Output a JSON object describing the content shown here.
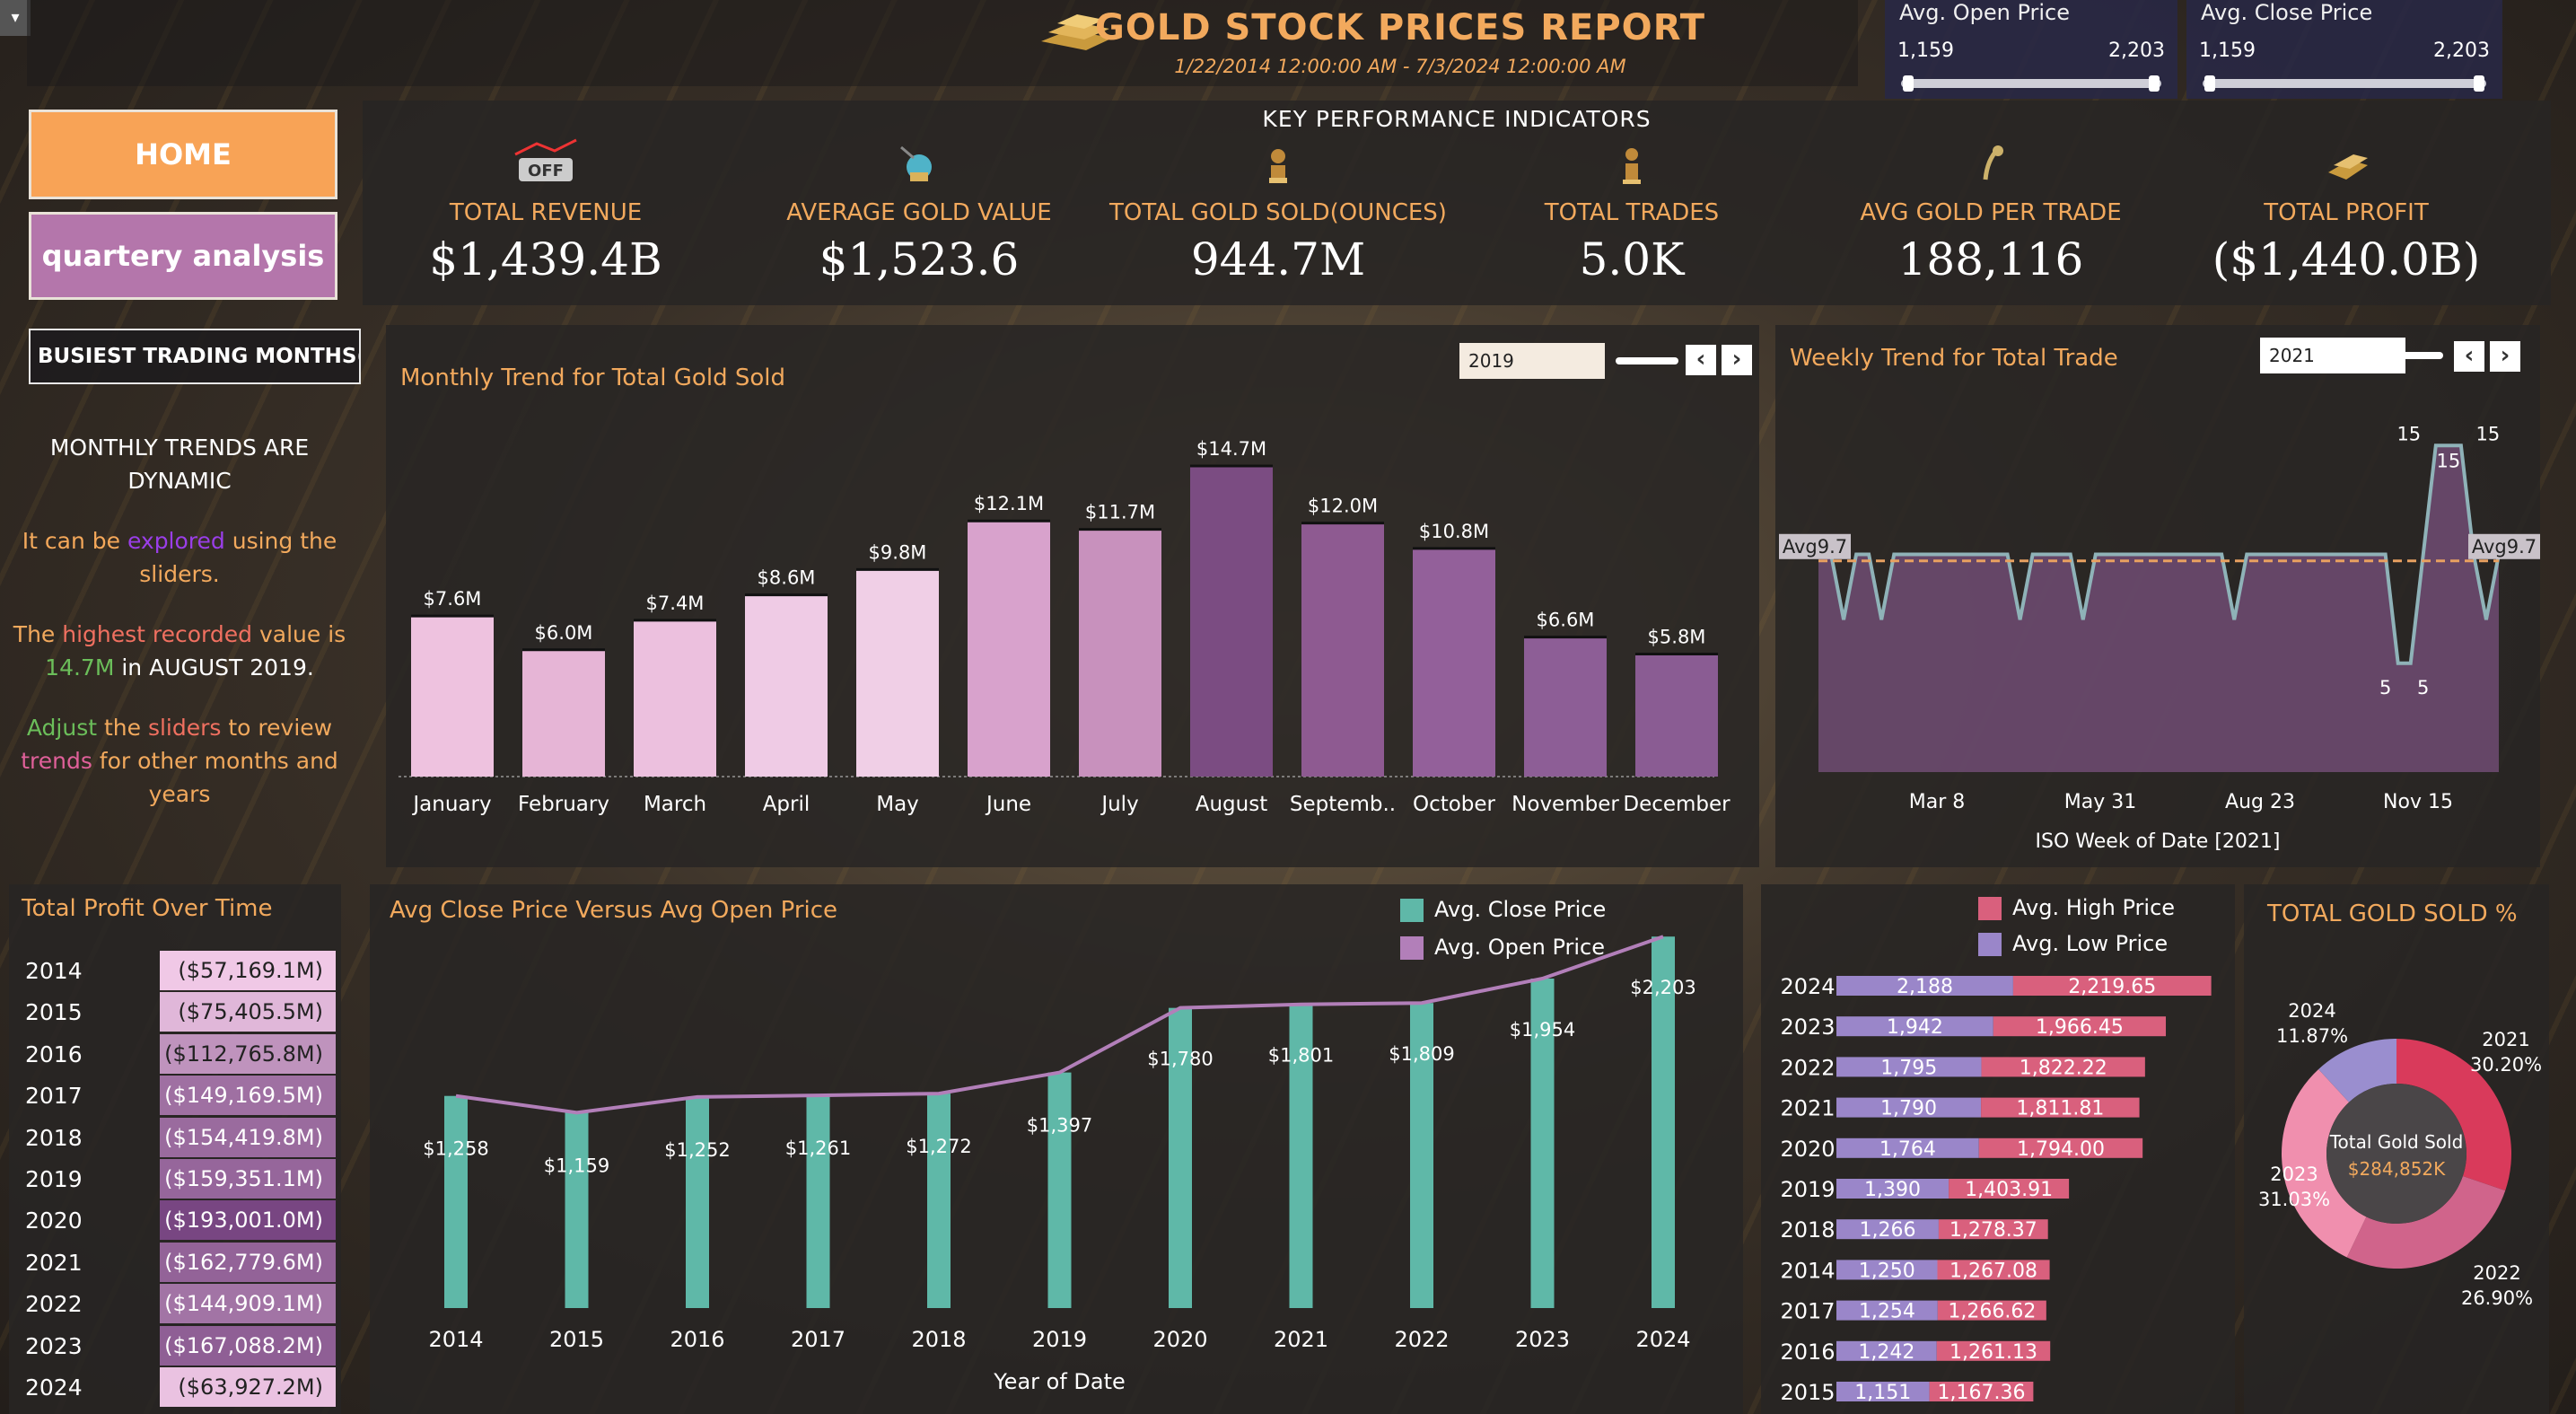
{
  "header": {
    "title": "GOLD STOCK PRICES REPORT",
    "subtitle": "1/22/2014 12:00:00 AM - 7/3/2024 12:00:00 AM"
  },
  "sliders": {
    "open": {
      "title": "Avg. Open Price",
      "min": "1,159",
      "max": "2,203"
    },
    "close": {
      "title": "Avg. Close Price",
      "min": "1,159",
      "max": "2,203"
    }
  },
  "nav": {
    "home": "HOME",
    "quarterly": "quartery analysis"
  },
  "kpi": {
    "heading": "KEY  PERFORMANCE  INDICATORS",
    "items": [
      {
        "label": "TOTAL REVENUE",
        "value": "$1,439.4B",
        "icon": "revenue-icon"
      },
      {
        "label": "AVERAGE GOLD VALUE",
        "value": "$1,523.6",
        "icon": "gold-value-icon"
      },
      {
        "label": "TOTAL GOLD SOLD(OUNCES)",
        "value": "944.7M",
        "icon": "gold-sold-icon"
      },
      {
        "label": "TOTAL TRADES",
        "value": "5.0K",
        "icon": "trades-icon"
      },
      {
        "label": "AVG GOLD PER TRADE",
        "value": "188,116",
        "icon": "avg-gold-icon"
      },
      {
        "label": "TOTAL PROFIT",
        "value": "($1,440.0B)",
        "icon": "profit-icon"
      }
    ]
  },
  "busiest": "BUSIEST TRADING MONTHS(G..",
  "story": {
    "p1": "MONTHLY TRENDS ARE DYNAMIC",
    "p2a": "It ",
    "p2b": "can be ",
    "p2c": "explored",
    "p2d": " using the sliders.",
    "p3a": "The ",
    "p3b": "highest recorded",
    "p3c": " value is ",
    "p3d": "14.7M",
    "p3e": " in AUGUST 2019.",
    "p4a": "Adjust",
    "p4b": " the ",
    "p4c": "sliders",
    "p4d": " to review ",
    "p4e": "trends",
    "p4f": " for other months and years"
  },
  "monthly": {
    "title": "Monthly Trend for Total Gold Sold",
    "filter": "2019"
  },
  "weekly": {
    "title": "Weekly Trend for Total Trade",
    "filter": "2021",
    "xlabel": "ISO Week of Date [2021]"
  },
  "profit": {
    "title": "Total Profit Over Time",
    "rows": [
      {
        "year": "2014",
        "value": "($57,169.1M)",
        "v": 57169.1
      },
      {
        "year": "2015",
        "value": "($75,405.5M)",
        "v": 75405.5
      },
      {
        "year": "2016",
        "value": "($112,765.8M)",
        "v": 112765.8
      },
      {
        "year": "2017",
        "value": "($149,169.5M)",
        "v": 149169.5
      },
      {
        "year": "2018",
        "value": "($154,419.8M)",
        "v": 154419.8
      },
      {
        "year": "2019",
        "value": "($159,351.1M)",
        "v": 159351.1
      },
      {
        "year": "2020",
        "value": "($193,001.0M)",
        "v": 193001.0
      },
      {
        "year": "2021",
        "value": "($162,779.6M)",
        "v": 162779.6
      },
      {
        "year": "2022",
        "value": "($144,909.1M)",
        "v": 144909.1
      },
      {
        "year": "2023",
        "value": "($167,088.2M)",
        "v": 167088.2
      },
      {
        "year": "2024",
        "value": "($63,927.2M)",
        "v": 63927.2
      }
    ]
  },
  "cvo": {
    "title": "Avg Close Price  Versus Avg Open Price",
    "legend_close": "Avg. Close Price",
    "legend_open": "Avg. Open Price",
    "xlabel": "Year of Date"
  },
  "hl": {
    "legend_high": "Avg. High Price",
    "legend_low": "Avg. Low Price"
  },
  "donut": {
    "title": "TOTAL GOLD SOLD %",
    "center_label": "Total Gold Sold",
    "center_value": "$284,852K"
  },
  "colors": {
    "accent": "#f2a95d",
    "teal": "#5fb8a8",
    "purple_line": "#b27fb9",
    "high": "#d9607d",
    "low": "#9a86c9"
  },
  "chart_data": [
    {
      "type": "bar",
      "title": "Monthly Trend for Total Gold Sold",
      "categories": [
        "January",
        "February",
        "March",
        "April",
        "May",
        "June",
        "July",
        "August",
        "Septemb..",
        "October",
        "November",
        "December"
      ],
      "values": [
        7.6,
        6.0,
        7.4,
        8.6,
        9.8,
        12.1,
        11.7,
        14.7,
        12.0,
        10.8,
        6.6,
        5.8
      ],
      "labels": [
        "$7.6M",
        "$6.0M",
        "$7.4M",
        "$8.6M",
        "$9.8M",
        "$12.1M",
        "$11.7M",
        "$14.7M",
        "$12.0M",
        "$10.8M",
        "$6.6M",
        "$5.8M"
      ]
    },
    {
      "type": "area",
      "title": "Weekly Trend for Total Trade",
      "ticks": [
        "Mar 8",
        "May 31",
        "Aug 23",
        "Nov 15"
      ],
      "values": [
        10,
        10,
        7,
        10,
        10,
        7,
        10,
        10,
        10,
        10,
        10,
        10,
        10,
        10,
        10,
        10,
        7,
        10,
        10,
        10,
        10,
        7,
        10,
        10,
        10,
        10,
        10,
        10,
        10,
        10,
        10,
        10,
        10,
        7,
        10,
        10,
        10,
        10,
        10,
        10,
        10,
        10,
        10,
        10,
        10,
        10,
        5,
        5,
        10,
        15,
        15,
        15,
        10,
        7,
        10
      ],
      "avg_label": "Avg9.7",
      "avg": 9.7,
      "annotations": [
        "15",
        "15",
        "15",
        "5",
        "5"
      ],
      "xlabel": "ISO Week of Date [2021]"
    },
    {
      "type": "bar",
      "title": "Avg Close Price  Versus Avg Open Price",
      "categories": [
        "2014",
        "2015",
        "2016",
        "2017",
        "2018",
        "2019",
        "2020",
        "2021",
        "2022",
        "2023",
        "2024"
      ],
      "series": [
        {
          "name": "Avg. Close Price",
          "values": [
            1258,
            1159,
            1252,
            1261,
            1272,
            1397,
            1780,
            1801,
            1809,
            1954,
            2203
          ]
        },
        {
          "name": "Avg. Open Price",
          "values": [
            1258,
            1159,
            1252,
            1261,
            1272,
            1397,
            1780,
            1801,
            1809,
            1954,
            2203
          ]
        }
      ],
      "labels": [
        "$1,258",
        "$1,159",
        "$1,252",
        "$1,261",
        "$1,272",
        "$1,397",
        "$1,780",
        "$1,801",
        "$1,809",
        "$1,954",
        "$2,203"
      ],
      "xlabel": "Year of Date"
    },
    {
      "type": "bar",
      "categories": [
        "2024",
        "2023",
        "2022",
        "2021",
        "2020",
        "2019",
        "2018",
        "2014",
        "2017",
        "2016",
        "2015"
      ],
      "series": [
        {
          "name": "Avg. Low Price",
          "values": [
            2188,
            1942,
            1795,
            1790,
            1764,
            1390,
            1266,
            1250,
            1254,
            1242,
            1151
          ],
          "labels": [
            "2,188",
            "1,942",
            "1,795",
            "1,790",
            "1,764",
            "1,390",
            "1,266",
            "1,250",
            "1,254",
            "1,242",
            "1,151"
          ]
        },
        {
          "name": "Avg. High Price",
          "values": [
            2219.65,
            1966.45,
            1822.22,
            1811.81,
            1794.0,
            1403.91,
            1278.37,
            1267.08,
            1266.62,
            1261.13,
            1167.36
          ],
          "labels": [
            "2,219.65",
            "1,966.45",
            "1,822.22",
            "1,811.81",
            "1,794.00",
            "1,403.91",
            "1,278.37",
            "1,267.08",
            "1,266.62",
            "1,261.13",
            "1,167.36"
          ]
        }
      ]
    },
    {
      "type": "pie",
      "title": "TOTAL GOLD SOLD %",
      "slices": [
        {
          "name": "2021",
          "pct": "30.20%",
          "value": 30.2,
          "color": "#d93a5b"
        },
        {
          "name": "2022",
          "pct": "26.90%",
          "value": 26.9,
          "color": "#d0648b"
        },
        {
          "name": "2023",
          "pct": "31.03%",
          "value": 31.03,
          "color": "#f08fae"
        },
        {
          "name": "2024",
          "pct": "11.87%",
          "value": 11.87,
          "color": "#9a8ecf"
        }
      ]
    }
  ]
}
